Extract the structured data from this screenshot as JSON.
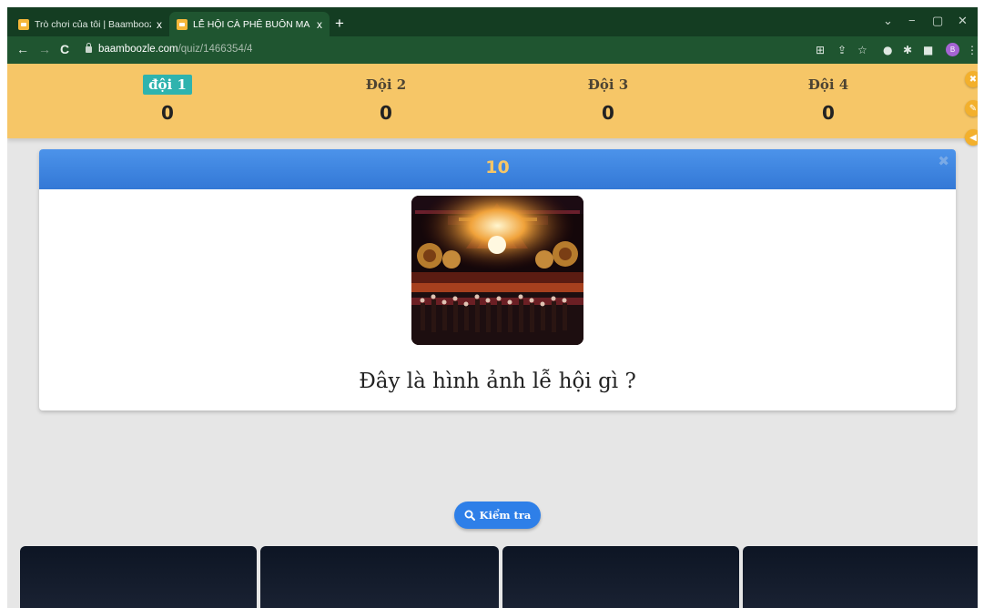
{
  "browser": {
    "tabs": [
      {
        "title": "Trò chơi của tôi | Baamboozle - B",
        "close": "x",
        "active": false
      },
      {
        "title": "LỄ HỘI CÀ PHÊ BUÔN MA THUỘ",
        "close": "x",
        "active": true
      }
    ],
    "new_tab": "+",
    "window_controls": {
      "minimize": "−",
      "maximize": "▢",
      "close": "✕",
      "tab_search": "⌄"
    },
    "nav": {
      "back": "←",
      "forward": "→",
      "reload": "C"
    },
    "url_host": "baamboozle.com",
    "url_path": "/quiz/1466354/4",
    "profile_initial": "B"
  },
  "teams": [
    {
      "name": "đội 1",
      "score": "0",
      "active": true
    },
    {
      "name": "Đội 2",
      "score": "0",
      "active": false
    },
    {
      "name": "Đội 3",
      "score": "0",
      "active": false
    },
    {
      "name": "Đội 4",
      "score": "0",
      "active": false
    }
  ],
  "side_buttons": {
    "close": "✖",
    "edit": "✎",
    "sound": "◀"
  },
  "question": {
    "points": "10",
    "close": "✖",
    "text": "Đây là hình ảnh lễ hội gì ?"
  },
  "check_button": {
    "label": "Kiểm tra",
    "icon": "search-icon"
  },
  "colors": {
    "header_yellow": "#f6c667",
    "active_team": "#2fb3ae",
    "card_header_blue": "#3d86e0",
    "points_text": "#f6c667",
    "button_blue": "#2e7fe8",
    "chrome_green": "#1f5530"
  }
}
